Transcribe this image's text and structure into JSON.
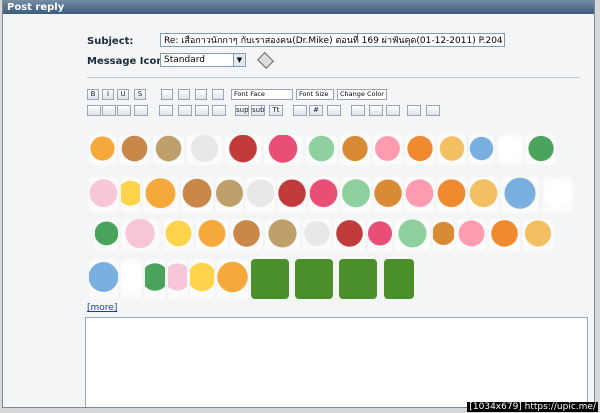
{
  "title": "Post reply",
  "subject": {
    "label": "Subject:",
    "value": "Re: เสือกาวนักกาๆ กับเราสองคน(Dr.Mike) ตอนที่ 169 ผ่าฟันคุด(01-12-2011) P.204"
  },
  "message_icon": {
    "label": "Message Icon:",
    "value": "Standard"
  },
  "toolbar": {
    "font_face": "Font Face",
    "font_size": "Font Size",
    "change_color": "Change Color",
    "row1": [
      "B",
      "I",
      "U",
      "S",
      "",
      "",
      "",
      "",
      "",
      "",
      "",
      "",
      "",
      "",
      "",
      "",
      "",
      ""
    ],
    "row2": [
      "",
      "",
      "",
      "",
      "",
      "",
      "",
      "",
      "sup",
      "sub",
      "Tt",
      "",
      "#",
      "",
      "",
      "",
      "",
      ""
    ]
  },
  "more_label": "[more]",
  "watermark": "[1034x679] https://upic.me/"
}
